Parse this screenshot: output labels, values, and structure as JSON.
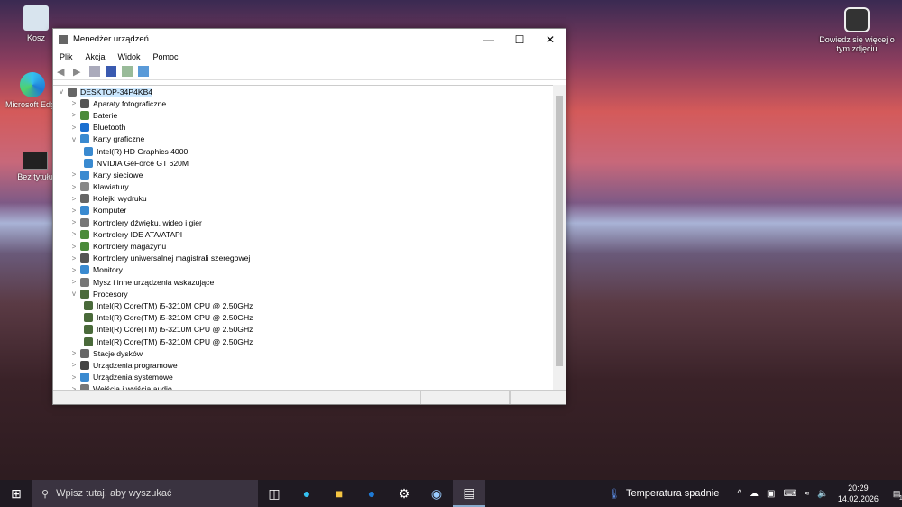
{
  "desktop": {
    "icons": [
      "Kosz",
      "Microsoft Edge",
      "Bez tytułu"
    ],
    "photo_info": "Dowiedz się więcej o tym zdjęciu"
  },
  "window": {
    "title": "Menedżer urządzeń",
    "menu": [
      "Plik",
      "Akcja",
      "Widok",
      "Pomoc"
    ],
    "root": "DESKTOP-34P4KB4",
    "tree": [
      {
        "label": "Aparaty fotograficzne",
        "level": 1,
        "exp": ">",
        "color": "#555"
      },
      {
        "label": "Baterie",
        "level": 1,
        "exp": ">",
        "color": "#4a8a3a"
      },
      {
        "label": "Bluetooth",
        "level": 1,
        "exp": ">",
        "color": "#1a6fd0"
      },
      {
        "label": "Karty graficzne",
        "level": 1,
        "exp": "v",
        "color": "#3a8ad0"
      },
      {
        "label": "Intel(R) HD Graphics 4000",
        "level": 2,
        "exp": "",
        "color": "#3a8ad0"
      },
      {
        "label": "NVIDIA GeForce GT 620M",
        "level": 2,
        "exp": "",
        "color": "#3a8ad0"
      },
      {
        "label": "Karty sieciowe",
        "level": 1,
        "exp": ">",
        "color": "#3a8ad0"
      },
      {
        "label": "Klawiatury",
        "level": 1,
        "exp": ">",
        "color": "#888"
      },
      {
        "label": "Kolejki wydruku",
        "level": 1,
        "exp": ">",
        "color": "#666"
      },
      {
        "label": "Komputer",
        "level": 1,
        "exp": ">",
        "color": "#3a8ad0"
      },
      {
        "label": "Kontrolery dźwięku, wideo i gier",
        "level": 1,
        "exp": ">",
        "color": "#777"
      },
      {
        "label": "Kontrolery IDE ATA/ATAPI",
        "level": 1,
        "exp": ">",
        "color": "#4a8a3a"
      },
      {
        "label": "Kontrolery magazynu",
        "level": 1,
        "exp": ">",
        "color": "#4a8a3a"
      },
      {
        "label": "Kontrolery uniwersalnej magistrali szeregowej",
        "level": 1,
        "exp": ">",
        "color": "#555"
      },
      {
        "label": "Monitory",
        "level": 1,
        "exp": ">",
        "color": "#3a8ad0"
      },
      {
        "label": "Mysz i inne urządzenia wskazujące",
        "level": 1,
        "exp": ">",
        "color": "#777"
      },
      {
        "label": "Procesory",
        "level": 1,
        "exp": "v",
        "color": "#4a6a3a"
      },
      {
        "label": "Intel(R) Core(TM) i5-3210M CPU @ 2.50GHz",
        "level": 2,
        "exp": "",
        "color": "#4a6a3a"
      },
      {
        "label": "Intel(R) Core(TM) i5-3210M CPU @ 2.50GHz",
        "level": 2,
        "exp": "",
        "color": "#4a6a3a"
      },
      {
        "label": "Intel(R) Core(TM) i5-3210M CPU @ 2.50GHz",
        "level": 2,
        "exp": "",
        "color": "#4a6a3a"
      },
      {
        "label": "Intel(R) Core(TM) i5-3210M CPU @ 2.50GHz",
        "level": 2,
        "exp": "",
        "color": "#4a6a3a"
      },
      {
        "label": "Stacje dysków",
        "level": 1,
        "exp": ">",
        "color": "#666"
      },
      {
        "label": "Urządzenia programowe",
        "level": 1,
        "exp": ">",
        "color": "#444"
      },
      {
        "label": "Urządzenia systemowe",
        "level": 1,
        "exp": ">",
        "color": "#3a8ad0"
      },
      {
        "label": "Wejścia i wyjścia audio",
        "level": 1,
        "exp": ">",
        "color": "#777"
      }
    ]
  },
  "taskbar": {
    "search_placeholder": "Wpisz tutaj, aby wyszukać",
    "weather": "Temperatura spadnie",
    "time": "20:29",
    "date": "14.02.2026",
    "notifications": "1"
  }
}
